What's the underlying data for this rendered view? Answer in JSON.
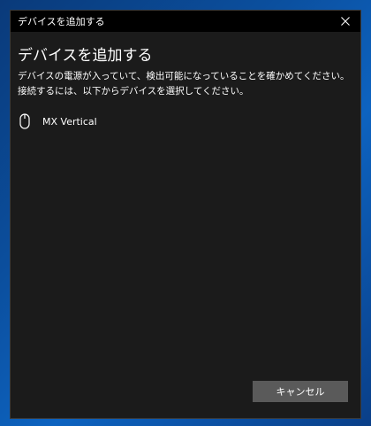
{
  "window": {
    "title": "デバイスを追加する"
  },
  "dialog": {
    "heading": "デバイスを追加する",
    "description": "デバイスの電源が入っていて、検出可能になっていることを確かめてください。接続するには、以下からデバイスを選択してください。",
    "devices": [
      {
        "name": "MX Vertical",
        "icon": "mouse-icon"
      }
    ],
    "cancel_label": "キャンセル"
  },
  "colors": {
    "dialog_bg": "#1b1b1b",
    "titlebar_bg": "#000000",
    "text": "#ffffff",
    "button_bg": "#5a5a5a",
    "desktop_bg": "#0b4f9e"
  }
}
